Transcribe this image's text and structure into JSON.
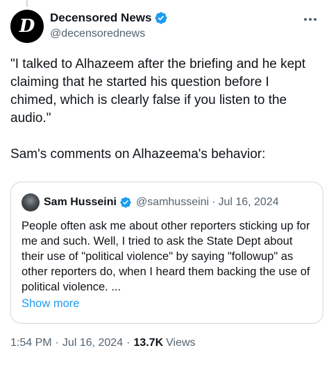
{
  "author": {
    "avatar_letter": "D",
    "display_name": "Decensored News",
    "handle": "@decensorednews"
  },
  "tweet": {
    "text": "\"I talked to Alhazeem after the briefing and he kept claiming that he started his question before I chimed, which is clearly false if you listen to the audio.\"\n\nSam's comments on Alhazeema's behavior:"
  },
  "quote": {
    "display_name": "Sam Husseini",
    "handle": "@samhusseini",
    "separator": "·",
    "date": "Jul 16, 2024",
    "text": "People often ask me about other reporters sticking up for me and such. Well, I tried to ask the State Dept about their use of \"political violence\" by saying \"followup\" as other reporters do, when I heard them backing the use of political violence. ...",
    "show_more": "Show more"
  },
  "meta": {
    "time": "1:54 PM",
    "separator": "·",
    "date": "Jul 16, 2024",
    "views_count": "13.7K",
    "views_label": "Views"
  },
  "colors": {
    "verified": "#1d9bf0",
    "link": "#1d9bf0",
    "secondary_text": "#536471",
    "border": "#cfd9de"
  },
  "icons": {
    "verified": "verified-badge-icon",
    "more": "more-options-icon"
  }
}
